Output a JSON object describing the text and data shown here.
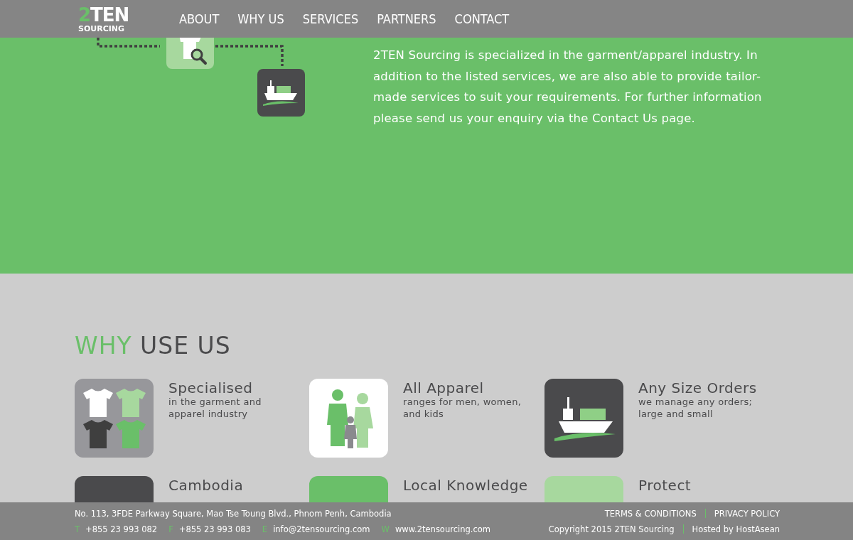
{
  "header": {
    "logo": {
      "number": "2",
      "word": "TEN",
      "tagline": "SOURCING"
    },
    "nav": [
      {
        "label": "ABOUT"
      },
      {
        "label": "WHY US"
      },
      {
        "label": "SERVICES"
      },
      {
        "label": "PARTNERS"
      },
      {
        "label": "CONTACT"
      }
    ]
  },
  "intro": {
    "text": "2TEN Sourcing is specialized in the garment/apparel industry.  In addition to the listed services, we are also able to provide tailor-made services to suit your requirements. For further information please send us your enquiry via the Contact Us page."
  },
  "why": {
    "heading_accent": "WHY",
    "heading_rest": "USE US",
    "features": [
      {
        "kind": "shirts",
        "title": "Specialised",
        "text": "in the garment and apparel industry"
      },
      {
        "kind": "family",
        "title": "All Apparel",
        "text": "ranges for men, women, and kids"
      },
      {
        "kind": "ship",
        "title": "Any Size Orders",
        "text": "we manage any orders; large and small"
      },
      {
        "kind": "dark",
        "title": "Cambodia"
      },
      {
        "kind": "green",
        "title": "Local Knowledge"
      },
      {
        "kind": "light",
        "title": "Protect"
      }
    ]
  },
  "footer": {
    "address": "No. 113, 3FDE Parkway Square, Mao Tse Toung Blvd., Phnom Penh, Cambodia",
    "contacts": [
      {
        "letter": "T",
        "value": "+855 23 993 082"
      },
      {
        "letter": "F",
        "value": "+855 23 993 083"
      },
      {
        "letter": "E",
        "value": "info@2tensourcing.com"
      },
      {
        "letter": "W",
        "value": "www.2tensourcing.com"
      }
    ],
    "links": [
      "TERMS & CONDITIONS",
      "PRIVACY POLICY"
    ],
    "copyright": "Copyright 2015 2TEN Sourcing",
    "hosted": "Hosted by HostAsean"
  }
}
